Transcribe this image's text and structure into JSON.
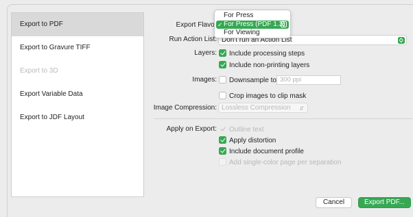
{
  "sidebar": {
    "items": [
      {
        "label": "Export to PDF",
        "state": "selected"
      },
      {
        "label": "Export to Gravure TIFF",
        "state": "normal"
      },
      {
        "label": "Export to 3D",
        "state": "disabled"
      },
      {
        "label": "Export Variable Data",
        "state": "normal"
      },
      {
        "label": "Export to JDF Layout",
        "state": "normal"
      }
    ]
  },
  "form": {
    "export_flavor": {
      "label": "Export Flavor",
      "popup_options": [
        "For Press",
        "For Press (PDF 1.3)",
        "For Viewing"
      ],
      "selected": "For Press (PDF 1.3)"
    },
    "run_action_list": {
      "label": "Run Action List:",
      "value": "Don't run an Action List"
    },
    "layers": {
      "label": "Layers:",
      "options": [
        {
          "label": "Include processing steps",
          "checked": true
        },
        {
          "label": "Include non-printing layers",
          "checked": true
        }
      ]
    },
    "images": {
      "label": "Images:",
      "downsample_label": "Downsample to",
      "downsample_checked": false,
      "downsample_placeholder": "300 ppi",
      "crop_label": "Crop images to clip mask",
      "crop_checked": false
    },
    "image_compression": {
      "label": "Image Compression:",
      "value": "Lossless Compression"
    },
    "apply_on_export": {
      "label": "Apply on Export:",
      "options": [
        {
          "label": "Outline text",
          "state": "disabled-checked"
        },
        {
          "label": "Apply distortion",
          "state": "checked"
        },
        {
          "label": "Include document profile",
          "state": "checked"
        },
        {
          "label": "Add single-color page per separation",
          "state": "disabled-unchecked"
        }
      ]
    }
  },
  "buttons": {
    "cancel": "Cancel",
    "export": "Export PDF..."
  },
  "icons": {
    "checkmark": "checkmark-icon",
    "stepper": "up-down-chevron-icon"
  },
  "colors": {
    "accent": "#36a853",
    "selection": "#d9d9d9"
  }
}
